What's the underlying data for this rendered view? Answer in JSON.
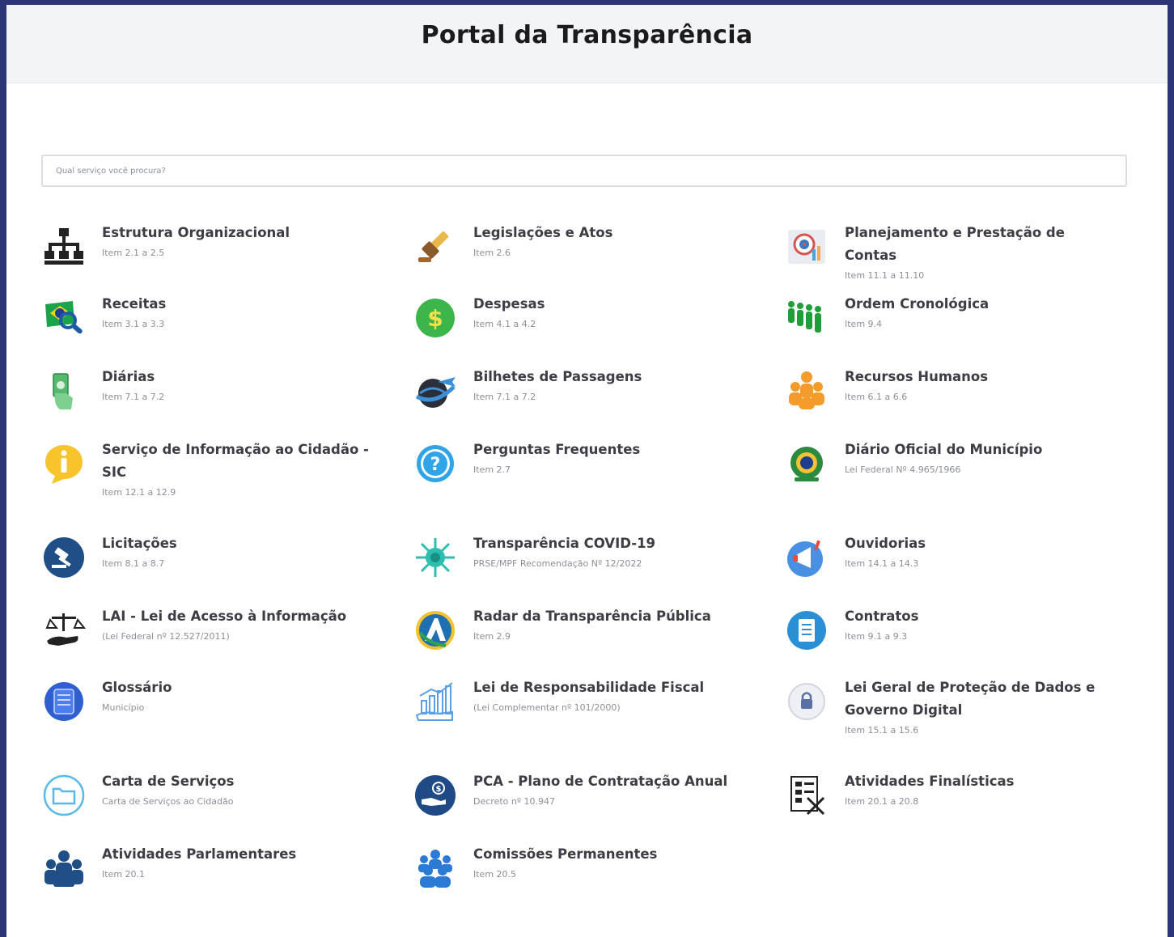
{
  "header": {
    "title": "Portal da Transparência"
  },
  "search": {
    "placeholder": "Qual serviço você procura?"
  },
  "items": [
    {
      "title": "Estrutura Organizacional",
      "subtitle": "Item 2.1 a 2.5",
      "icon": "org-chart-icon"
    },
    {
      "title": "Legislações e Atos",
      "subtitle": "Item 2.6",
      "icon": "gavel-icon"
    },
    {
      "title": "Planejamento e Prestação de Contas",
      "subtitle": "Item 11.1 a 11.10",
      "icon": "planning-target-icon"
    },
    {
      "title": "Receitas",
      "subtitle": "Item 3.1 a 3.3",
      "icon": "brazil-flag-magnifier-icon"
    },
    {
      "title": "Despesas",
      "subtitle": "Item 4.1 a 4.2",
      "icon": "dollar-coin-icon"
    },
    {
      "title": "Ordem Cronológica",
      "subtitle": "Item 9.4",
      "icon": "people-queue-icon"
    },
    {
      "title": "Diárias",
      "subtitle": "Item 7.1 a 7.2",
      "icon": "hand-money-icon"
    },
    {
      "title": "Bilhetes de Passagens",
      "subtitle": "Item 7.1 a 7.2",
      "icon": "globe-airplane-icon"
    },
    {
      "title": "Recursos Humanos",
      "subtitle": "Item 6.1 a 6.6",
      "icon": "people-group-icon"
    },
    {
      "title": "Serviço de Informação ao Cidadão - SIC",
      "subtitle": "Item 12.1 a 12.9",
      "icon": "info-bubble-icon"
    },
    {
      "title": "Perguntas Frequentes",
      "subtitle": "Item 2.7",
      "icon": "question-circle-icon"
    },
    {
      "title": "Diário Oficial do Município",
      "subtitle": "Lei Federal Nº 4.965/1966",
      "icon": "brazil-coat-of-arms-icon"
    },
    {
      "title": "Licitações",
      "subtitle": "Item 8.1 a 8.7",
      "icon": "auction-hammer-icon"
    },
    {
      "title": "Transparência COVID-19",
      "subtitle": "PRSE/MPF Recomendação Nº 12/2022",
      "icon": "virus-icon"
    },
    {
      "title": "Ouvidorias",
      "subtitle": "Item 14.1 a 14.3",
      "icon": "megaphone-icon"
    },
    {
      "title": "LAI - Lei de Acesso à Informação",
      "subtitle": "(Lei Federal nº 12.527/2011)",
      "icon": "scales-hand-icon"
    },
    {
      "title": "Radar da Transparência Pública",
      "subtitle": "Item 2.9",
      "icon": "radar-logo-icon"
    },
    {
      "title": "Contratos",
      "subtitle": "Item 9.1 a 9.3",
      "icon": "document-circle-icon"
    },
    {
      "title": "Glossário",
      "subtitle": "Município",
      "icon": "book-icon"
    },
    {
      "title": "Lei de Responsabilidade Fiscal",
      "subtitle": "(Lei Complementar nº 101/2000)",
      "icon": "chart-hand-icon"
    },
    {
      "title": "Lei Geral de Proteção de Dados e Governo Digital",
      "subtitle": "Item 15.1 a 15.6",
      "icon": "lock-shield-icon"
    },
    {
      "title": "Carta de Serviços",
      "subtitle": "Carta de Serviços ao Cidadão",
      "icon": "folder-circle-icon"
    },
    {
      "title": "PCA - Plano de Contratação Anual",
      "subtitle": "Decreto nº 10.947",
      "icon": "money-hand-circle-icon"
    },
    {
      "title": "Atividades Finalísticas",
      "subtitle": "Item 20.1 a 20.8",
      "icon": "checklist-icon"
    },
    {
      "title": "Atividades Parlamentares",
      "subtitle": "Item 20.1",
      "icon": "parliament-people-icon"
    },
    {
      "title": "Comissões Permanentes",
      "subtitle": "Item 20.5",
      "icon": "committee-people-icon"
    }
  ]
}
